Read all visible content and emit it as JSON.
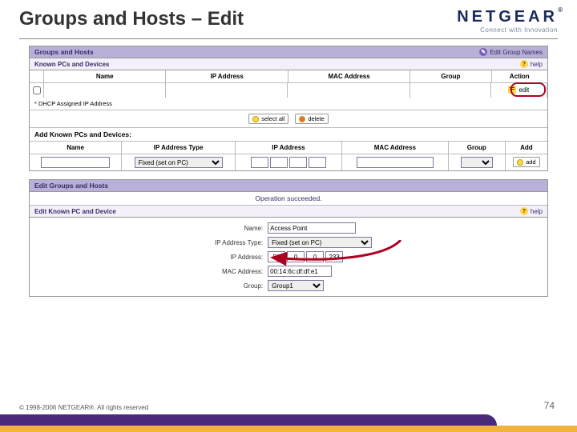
{
  "header": {
    "title": "Groups and Hosts – Edit",
    "logo_main": "NETGEAR",
    "logo_sub": "Connect with Innovation"
  },
  "panel1": {
    "title": "Groups and Hosts",
    "link_label": "Edit Group Names",
    "sub_title": "Known PCs and Devices",
    "help_label": "help",
    "columns": {
      "name": "Name",
      "ip": "IP Address",
      "mac": "MAC Address",
      "group": "Group",
      "action": "Action"
    },
    "action_edit": "edit",
    "note": "* DHCP Assigned IP Address",
    "btn_select_all": "select all",
    "btn_delete": "delete",
    "add_header": "Add Known PCs and Devices:",
    "cols2": {
      "nm": "Name",
      "tp": "IP Address Type",
      "ipa": "IP Address",
      "mca": "MAC Address",
      "gp": "Group",
      "ad": "Add"
    },
    "ip_type_option": "Fixed (set on PC)",
    "add_btn": "add"
  },
  "panel2": {
    "title": "Edit Groups and Hosts",
    "status": "Operation succeeded.",
    "sub_title": "Edit Known PC and Device",
    "help_label": "help",
    "form": {
      "name_lbl": "Name:",
      "name_val": "Access Point",
      "iptype_lbl": "IP Address Type:",
      "iptype_val": "Fixed (set on PC)",
      "ip_lbl": "IP Address:",
      "ip": [
        "50",
        "0",
        "0",
        "233"
      ],
      "mac_lbl": "MAC Address:",
      "mac_val": "00:14:6c:df:df:e1",
      "group_lbl": "Group:",
      "group_val": "Group1"
    }
  },
  "footer": {
    "copyright": "© 1998-2006 NETGEAR®. All rights reserved",
    "page": "74"
  }
}
